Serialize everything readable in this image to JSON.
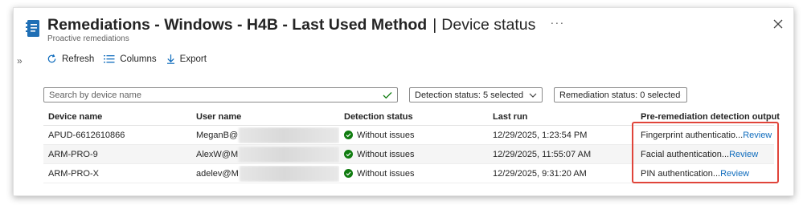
{
  "header": {
    "title_main": "Remediations - Windows - H4B - Last Used Method",
    "title_separator": "|",
    "title_sub": "Device status",
    "more_label": "···",
    "subtitle": "Proactive remediations"
  },
  "side": {
    "expand_label": "»"
  },
  "toolbar": {
    "refresh_label": "Refresh",
    "columns_label": "Columns",
    "export_label": "Export"
  },
  "filters": {
    "search_placeholder": "Search by device name",
    "detection_label": "Detection status: 5 selected",
    "remediation_label": "Remediation status: 0 selected"
  },
  "table": {
    "columns": [
      "Device name",
      "User name",
      "Detection status",
      "Last run",
      "Pre-remediation detection output"
    ],
    "rows": [
      {
        "device": "APUD-6612610866",
        "user": "MeganB@",
        "status": "Without issues",
        "last_run": "12/29/2025, 1:23:54 PM",
        "output": "Fingerprint authenticatio...",
        "link": "Review"
      },
      {
        "device": "ARM-PRO-9",
        "user": "AlexW@M",
        "status": "Without issues",
        "last_run": "12/29/2025, 11:55:07 AM",
        "output": "Facial authentication...",
        "link": "Review"
      },
      {
        "device": "ARM-PRO-X",
        "user": "adelev@M",
        "status": "Without issues",
        "last_run": "12/29/2025, 9:31:20 AM",
        "output": "PIN authentication...",
        "link": "Review"
      }
    ]
  },
  "colors": {
    "accent": "#0f6cbd",
    "success": "#107c10",
    "highlight": "#e0443a"
  }
}
